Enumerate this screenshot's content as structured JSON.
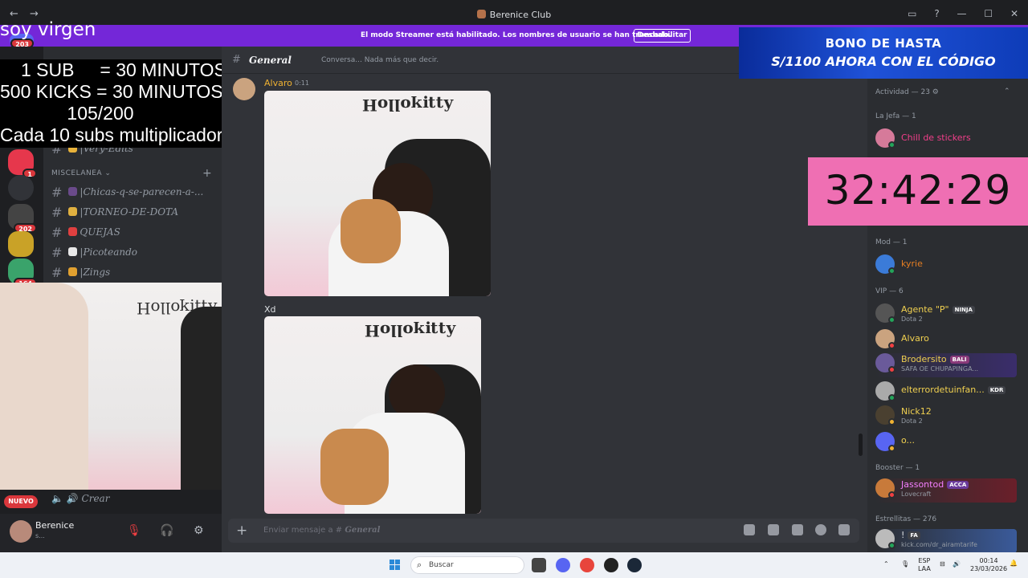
{
  "window": {
    "title": "Berenice Club",
    "back": "←",
    "forward": "→"
  },
  "streamer": {
    "message": "El modo Streamer está habilitado. Los nombres de usuario se han truncado.",
    "button": "Deshabilitar"
  },
  "overlay": {
    "title": "soy virgen",
    "rules": [
      "1 SUB     = 30 MINUTOS",
      "500 KICKS = 30 MINUTOS",
      "105/200",
      "Cada 10 subs multiplicador"
    ],
    "timer": "32:42:29",
    "banner_line1": "BONO DE HASTA",
    "banner_line2": "S/1100 AHORA CON EL CÓDIGO"
  },
  "servers": [
    {
      "badge": "203",
      "color": "#5865f2"
    },
    {
      "badge": "1",
      "color": "#e6374c"
    },
    {
      "badge": "",
      "color": "#313338"
    },
    {
      "badge": "202",
      "color": "#444"
    },
    {
      "badge": "",
      "color": "#c9a227"
    },
    {
      "badge": "164",
      "color": "#3aa36b"
    }
  ],
  "channels": {
    "category": "MISCELANEA",
    "items": [
      {
        "name": "Very-Edits",
        "emo_color": "#e8b23a"
      },
      {
        "name": "Chicas-q-se-parecen-a-...",
        "emo_color": "#6a4a8a"
      },
      {
        "name": "TORNEO-DE-DOTA",
        "emo_color": "#e0b040"
      },
      {
        "name": "QUEJAS",
        "emo_color": "#e04040"
      },
      {
        "name": "Picoteando",
        "emo_color": "#e8e8e8"
      },
      {
        "name": "Zings",
        "emo_color": "#e0a030"
      }
    ],
    "voice": "Crear",
    "nuevo": "NUEVO"
  },
  "user": {
    "name": "Berenice",
    "status": "s..."
  },
  "chat": {
    "channel_name": "General",
    "topic": "Conversa... Nada más que decir.",
    "author": "Alvaro",
    "time": "0:11",
    "caption": "Xd",
    "composer_prefix": "Enviar mensaje a #",
    "composer_channel": "General"
  },
  "members": {
    "activity_header": "Actividad — 23",
    "groups": [
      {
        "header": "La Jefa — 1",
        "items": [
          {
            "name": "Chill de stickers",
            "color": "#f23f8a",
            "activity": "",
            "tag": ""
          }
        ]
      },
      {
        "header": "Mod — 1",
        "items": [
          {
            "name": "kyrie",
            "color": "#e67e22",
            "activity": "",
            "tag": ""
          }
        ]
      },
      {
        "header": "VIP — 6",
        "items": [
          {
            "name": "Agente \"P\"",
            "color": "#f0d050",
            "activity": "Dota 2",
            "tag": "NINJA"
          },
          {
            "name": "Alvaro",
            "color": "#f0d050",
            "activity": "",
            "tag": ""
          },
          {
            "name": "Brodersito",
            "color": "#f0d050",
            "activity": "SAFA OE CHUPAPINGA...",
            "tag": "BALI"
          },
          {
            "name": "elterrordetuinfan...",
            "color": "#f0d050",
            "activity": "",
            "tag": "KDR"
          },
          {
            "name": "Nick12",
            "color": "#f0d050",
            "activity": "Dota 2",
            "tag": ""
          },
          {
            "name": "o...",
            "color": "#f0d050",
            "activity": "",
            "tag": ""
          }
        ]
      },
      {
        "header": "Booster — 1",
        "items": [
          {
            "name": "Jassontod",
            "color": "#f47fff",
            "activity": "Lovecraft",
            "tag": "ACCA"
          }
        ]
      },
      {
        "header": "Estrellitas — 276",
        "items": [
          {
            "name": "!",
            "color": "#dbdee1",
            "activity": "kick.com/dr_airamtarife",
            "tag": "FA"
          }
        ]
      }
    ]
  },
  "taskbar": {
    "search_placeholder": "Buscar",
    "lang": "ESP",
    "layout": "LAA",
    "time": "00:14",
    "date": "23/03/2026"
  }
}
